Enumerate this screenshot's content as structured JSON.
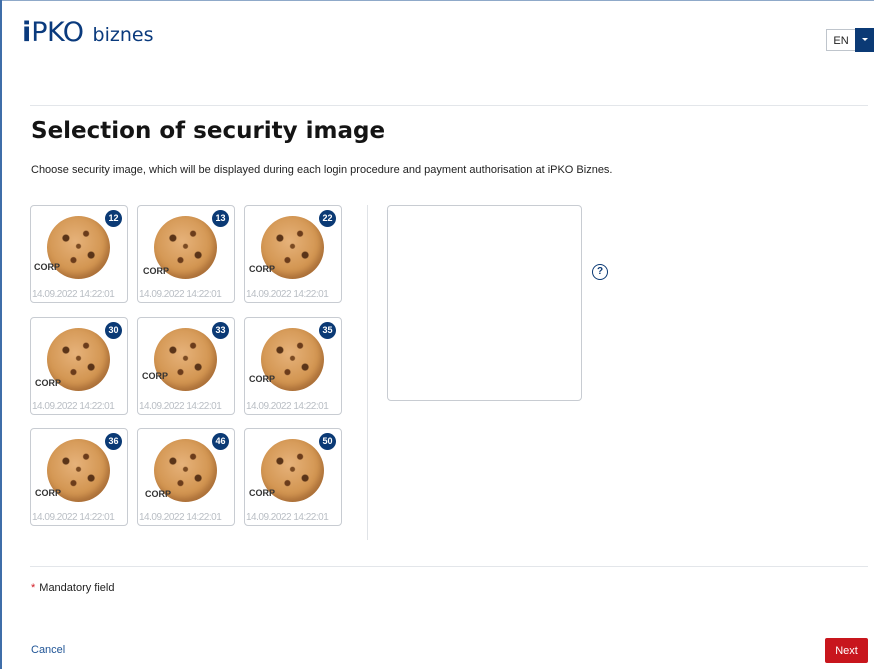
{
  "header": {
    "logo_i": "i",
    "logo_pko": "PKO",
    "logo_biznes": "biznes",
    "language": "EN"
  },
  "page": {
    "title": "Selection of security image",
    "description": "Choose security image, which will be displayed during each login procedure and payment authorisation at iPKO Biznes."
  },
  "images": [
    {
      "number": "12",
      "label": "CORP",
      "timestamp": "14.09.2022 14:22:01"
    },
    {
      "number": "13",
      "label": "CORP",
      "timestamp": "14.09.2022 14:22:01"
    },
    {
      "number": "22",
      "label": "CORP",
      "timestamp": "14.09.2022 14:22:01"
    },
    {
      "number": "30",
      "label": "CORP",
      "timestamp": "14.09.2022 14:22:01"
    },
    {
      "number": "33",
      "label": "CORP",
      "timestamp": "14.09.2022 14:22:01"
    },
    {
      "number": "35",
      "label": "CORP",
      "timestamp": "14.09.2022 14:22:01"
    },
    {
      "number": "36",
      "label": "CORP",
      "timestamp": "14.09.2022 14:22:01"
    },
    {
      "number": "46",
      "label": "CORP",
      "timestamp": "14.09.2022 14:22:01"
    },
    {
      "number": "50",
      "label": "CORP",
      "timestamp": "14.09.2022 14:22:01"
    }
  ],
  "help": {
    "symbol": "?"
  },
  "footer": {
    "mandatory_marker": "*",
    "mandatory_text": "Mandatory field",
    "cancel_label": "Cancel",
    "next_label": "Next"
  },
  "colors": {
    "brand_navy": "#0b3a75",
    "next_button": "#c8161d",
    "link": "#1f5496"
  }
}
